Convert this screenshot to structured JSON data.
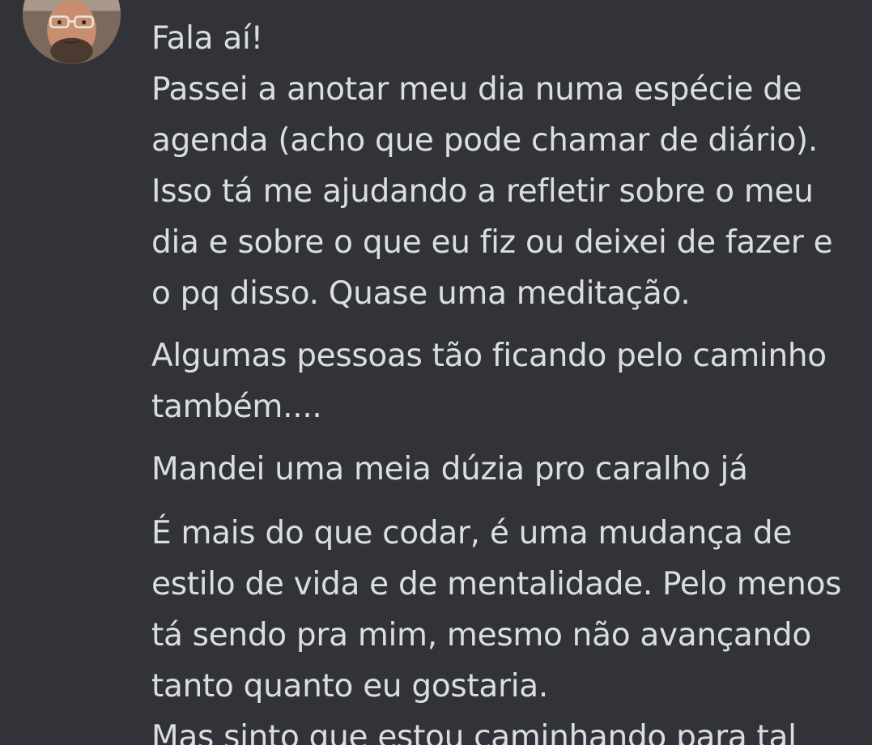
{
  "author": {
    "name": "",
    "name_color": "#2dc770",
    "avatar_icon": "user-avatar-photo"
  },
  "theme": {
    "background": "#313338",
    "text": "#dbdee1"
  },
  "messages": [
    {
      "lines": [
        "Fala aí!"
      ]
    },
    {
      "lines": [
        "Passei a anotar meu dia numa espécie de",
        "agenda (acho que pode chamar de diário).",
        "Isso tá me ajudando a refletir sobre o meu",
        "dia e sobre o que eu fiz ou deixei de fazer e",
        "o pq disso. Quase uma meditação."
      ]
    },
    {
      "lines": [
        "Algumas pessoas tão ficando pelo caminho",
        "também...."
      ]
    },
    {
      "lines": [
        "Mandei uma meia dúzia pro caralho já"
      ]
    },
    {
      "lines": [
        "É mais do que codar, é uma mudança de",
        "estilo de vida e de mentalidade. Pelo menos",
        "tá sendo pra mim, mesmo não avançando",
        "tanto quanto eu gostaria.",
        "Mas sinto que estou caminhando para tal"
      ]
    }
  ]
}
